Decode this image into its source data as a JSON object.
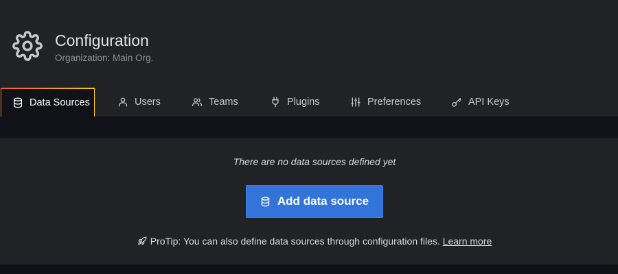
{
  "header": {
    "icon": "gear-icon",
    "title": "Configuration",
    "subtitle": "Organization: Main Org."
  },
  "tabs": [
    {
      "label": "Data Sources",
      "icon": "database-icon",
      "active": true
    },
    {
      "label": "Users",
      "icon": "user-icon",
      "active": false
    },
    {
      "label": "Teams",
      "icon": "users-icon",
      "active": false
    },
    {
      "label": "Plugins",
      "icon": "plug-icon",
      "active": false
    },
    {
      "label": "Preferences",
      "icon": "sliders-icon",
      "active": false
    },
    {
      "label": "API Keys",
      "icon": "key-icon",
      "active": false
    }
  ],
  "empty_state": {
    "message": "There are no data sources defined yet",
    "button_label": "Add data source",
    "button_icon": "database-icon",
    "protip_icon": "rocket-icon",
    "protip_text": "ProTip: You can also define data sources through configuration files.",
    "protip_link": "Learn more"
  },
  "colors": {
    "background": "#111217",
    "panel": "#202226",
    "primary_button": "#3274d9",
    "tab_accent_start": "#f05a28",
    "tab_accent_end": "#fbca0a"
  }
}
